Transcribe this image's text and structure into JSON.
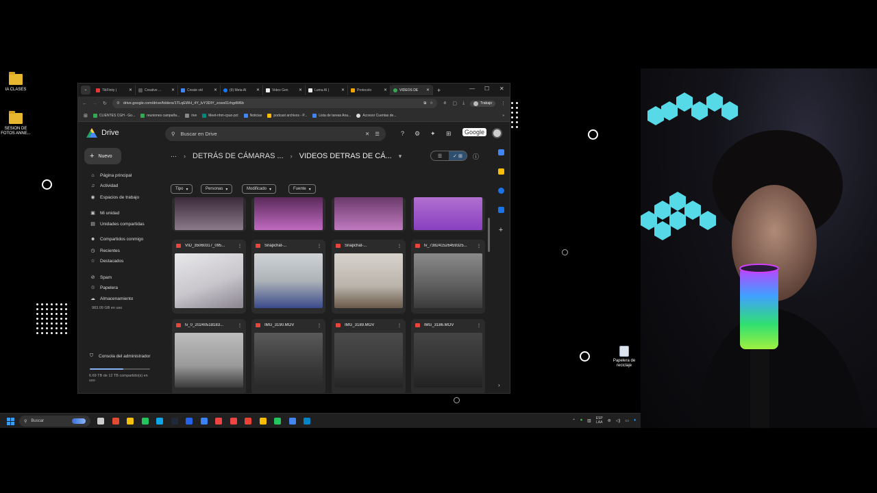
{
  "desktop": {
    "icons": [
      {
        "label": "IA CLASES"
      },
      {
        "label": "SESION DE FOTOS ANNE..."
      },
      {
        "label": "Papelera de reciclaje"
      }
    ]
  },
  "browser": {
    "tabs": [
      {
        "label": "TikFinity |",
        "color": "#e53935"
      },
      {
        "label": "Creative ...",
        "color": "#555555"
      },
      {
        "label": "Create vid",
        "color": "#4285f4"
      },
      {
        "label": "(9) Meta AI",
        "color": "#1877f2"
      },
      {
        "label": "Video Gen",
        "color": "#eeeeee"
      },
      {
        "label": "Luma AI |",
        "color": "#eeeeee"
      },
      {
        "label": "Protocolo",
        "color": "#f4a300"
      },
      {
        "label": "VIDEOS DE",
        "color": "#34a853"
      }
    ],
    "url": "drive.google.com/drive/folders/1TLqEWH_4Y_lvY3DIY_zcws01rhgdM6b",
    "profile_label": "Trabajo",
    "bookmarks": [
      {
        "label": "CLIENTES CGH - Go...",
        "color": "#34a853"
      },
      {
        "label": "reuniones campaña...",
        "color": "#34a853"
      },
      {
        "label": "rive",
        "color": "#888888"
      },
      {
        "label": "Meet-nhm-cpuo-pct",
        "color": "#00897b"
      },
      {
        "label": "Noticias",
        "color": "#4285f4"
      },
      {
        "label": "podcast archivos - P...",
        "color": "#fbbc04"
      },
      {
        "label": "Lista de tareas Ana...",
        "color": "#4285f4"
      },
      {
        "label": "Accesor Cuentas de...",
        "color": "#dddddd"
      }
    ]
  },
  "drive": {
    "brand": "Drive",
    "search_placeholder": "Buscar en Drive",
    "google_label": "Google",
    "new_label": "Nuevo",
    "nav": [
      {
        "label": "Página principal",
        "icon": "home-icon"
      },
      {
        "label": "Actividad",
        "icon": "bell-icon"
      },
      {
        "label": "Espacios de trabajo",
        "icon": "workspace-icon"
      },
      {
        "label": "Mi unidad",
        "icon": "drive-icon"
      },
      {
        "label": "Unidades compartidas",
        "icon": "shared-drive-icon"
      },
      {
        "label": "Compartidos conmigo",
        "icon": "people-icon"
      },
      {
        "label": "Recientes",
        "icon": "clock-icon"
      },
      {
        "label": "Destacados",
        "icon": "star-icon"
      },
      {
        "label": "Spam",
        "icon": "spam-icon"
      },
      {
        "label": "Papelera",
        "icon": "trash-icon"
      },
      {
        "label": "Almacenamiento",
        "icon": "cloud-icon"
      }
    ],
    "storage_used": "983.09 GB en uso",
    "admin_label": "Consola del administrador",
    "shared_storage": "6.69 TB de 12 TB compartido(s) en uso",
    "shared_storage_fraction": 0.56,
    "breadcrumb": [
      "DETRÁS DE CÁMARAS ...",
      "VIDEOS DETRAS DE CÁ..."
    ],
    "filters": [
      "Tipo",
      "Personas",
      "Modificado",
      "Fuente"
    ],
    "files": [
      {
        "name": "VID_35060317_095...",
        "thumb": "linear-gradient(160deg,#e8e8ea 0%,#c9c6cc 55%,#8a8590 100%)"
      },
      {
        "name": "Snapchat-...",
        "thumb": "linear-gradient(180deg,#cfd3d6 0%,#aeb3b8 50%,#3a4a8a 100%)"
      },
      {
        "name": "Snapchat-...",
        "thumb": "linear-gradient(180deg,#d7d3cc 0%,#b9b3aa 60%,#6a5a4a 100%)"
      },
      {
        "name": "lv_738241526459325...",
        "thumb": "linear-gradient(180deg,#8a8a8a 0%,#5e5e5e 60%,#3a3a3a 100%)"
      },
      {
        "name": "lv_0_20240518183...",
        "thumb": "linear-gradient(180deg,#bdbdbd 0%,#9a9a9a 60%,#3a3a3a 100%)"
      },
      {
        "name": "IMG_3190.MOV",
        "thumb": "linear-gradient(180deg,#5a5a5a 0%,#3a3a3a 60%,#2a2a2a 100%)"
      },
      {
        "name": "IMG_3189.MOV",
        "thumb": "linear-gradient(180deg,#4a4a4a 0%,#3a3a3a 60%,#242424 100%)"
      },
      {
        "name": "IMG_3186.MOV",
        "thumb": "linear-gradient(180deg,#444444 0%,#333333 60%,#222222 100%)"
      }
    ]
  },
  "taskbar": {
    "search_label": "Buscar",
    "lang_line1": "ESP",
    "lang_line2": "LAA",
    "apps": [
      "#cccccc",
      "#e34a32",
      "#f4c20d",
      "#22c55e",
      "#0ea5e9",
      "#1f2937",
      "#2563eb",
      "#3b82f6",
      "#ef4444",
      "#ef4444",
      "#ea4335",
      "#fbbc04",
      "#22c55e",
      "#4285f4",
      "#0284c7"
    ]
  }
}
